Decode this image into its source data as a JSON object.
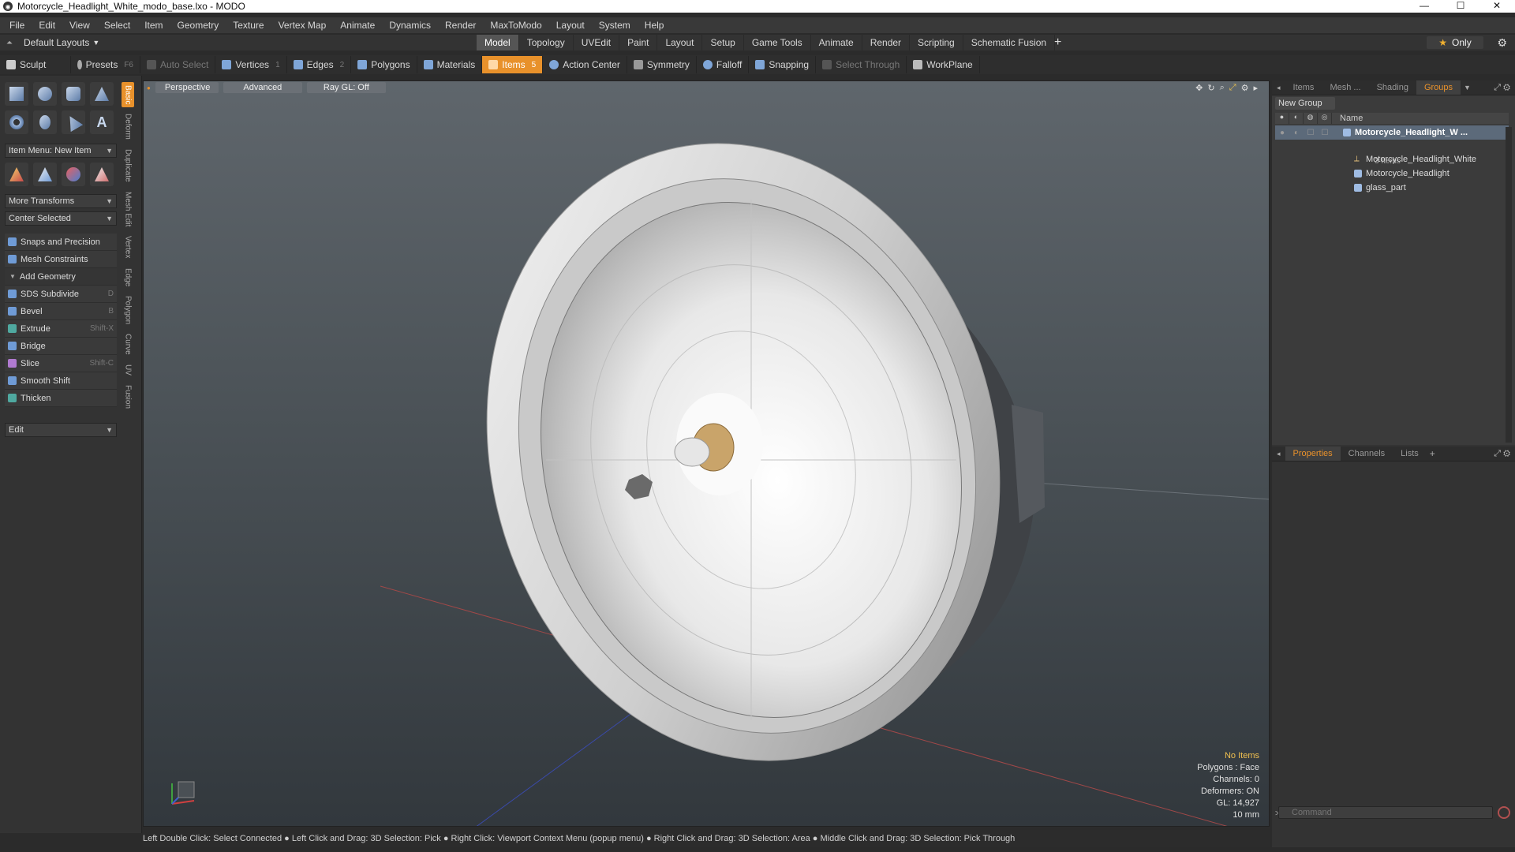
{
  "window": {
    "title": "Motorcycle_Headlight_White_modo_base.lxo - MODO",
    "minimize": "—",
    "maximize": "☐",
    "close": "✕"
  },
  "menu": [
    "File",
    "Edit",
    "View",
    "Select",
    "Item",
    "Geometry",
    "Texture",
    "Vertex Map",
    "Animate",
    "Dynamics",
    "Render",
    "MaxToModo",
    "Layout",
    "System",
    "Help"
  ],
  "modebar": {
    "layout_label": "Default Layouts",
    "tabs": [
      "Model",
      "Topology",
      "UVEdit",
      "Paint",
      "Layout",
      "Setup",
      "Game Tools",
      "Animate",
      "Render",
      "Scripting",
      "Schematic Fusion"
    ],
    "active_tab": "Model",
    "only_label": "Only"
  },
  "toolbar": {
    "sculpt": "Sculpt",
    "presets": "Presets",
    "presets_key": "F6",
    "auto_select": "Auto Select",
    "vertices": "Vertices",
    "vertices_count": "1",
    "edges": "Edges",
    "edges_count": "2",
    "polygons": "Polygons",
    "materials": "Materials",
    "items": "Items",
    "items_count": "5",
    "action_center": "Action Center",
    "symmetry": "Symmetry",
    "falloff": "Falloff",
    "snapping": "Snapping",
    "select_through": "Select Through",
    "workplane": "WorkPlane"
  },
  "leftpanel": {
    "item_menu": "Item Menu: New Item",
    "more_transforms": "More Transforms",
    "center_selected": "Center Selected",
    "snaps": "Snaps and Precision",
    "mesh_constraints": "Mesh Constraints",
    "add_geometry": "Add Geometry",
    "tools": [
      {
        "label": "SDS Subdivide",
        "key": "D"
      },
      {
        "label": "Bevel",
        "key": "B"
      },
      {
        "label": "Extrude",
        "key": "Shift-X"
      },
      {
        "label": "Bridge",
        "key": ""
      },
      {
        "label": "Slice",
        "key": "Shift-C"
      },
      {
        "label": "Smooth Shift",
        "key": ""
      },
      {
        "label": "Thicken",
        "key": ""
      }
    ],
    "edit": "Edit",
    "vtabs": [
      "Basic",
      "Deform",
      "Duplicate",
      "Mesh Edit",
      "Vertex",
      "Edge",
      "Polygon",
      "Curve",
      "UV",
      "Fusion"
    ]
  },
  "viewport": {
    "perspective": "Perspective",
    "advanced": "Advanced",
    "raygl": "Ray GL: Off",
    "hud": {
      "no_items": "No Items",
      "polygons": "Polygons : Face",
      "channels": "Channels: 0",
      "deformers": "Deformers: ON",
      "gl": "GL: 14,927",
      "scale": "10 mm"
    }
  },
  "statusbar": "Left Double Click: Select Connected ● Left Click and Drag: 3D Selection: Pick ● Right Click: Viewport Context Menu (popup menu) ● Right Click and Drag: 3D Selection: Area ● Middle Click and Drag: 3D Selection: Pick Through",
  "rightpanel": {
    "top_tabs": [
      "Items",
      "Mesh ...",
      "Shading",
      "Groups"
    ],
    "active_top_tab": "Groups",
    "new_group": "New Group",
    "name_col": "Name",
    "group_name": "Motorcycle_Headlight_W ...",
    "group_count": "3 Items",
    "children": [
      "Motorcycle_Headlight_White",
      "Motorcycle_Headlight",
      "glass_part"
    ],
    "bottom_tabs": [
      "Properties",
      "Channels",
      "Lists"
    ],
    "active_bottom_tab": "Properties",
    "command_placeholder": "Command"
  }
}
